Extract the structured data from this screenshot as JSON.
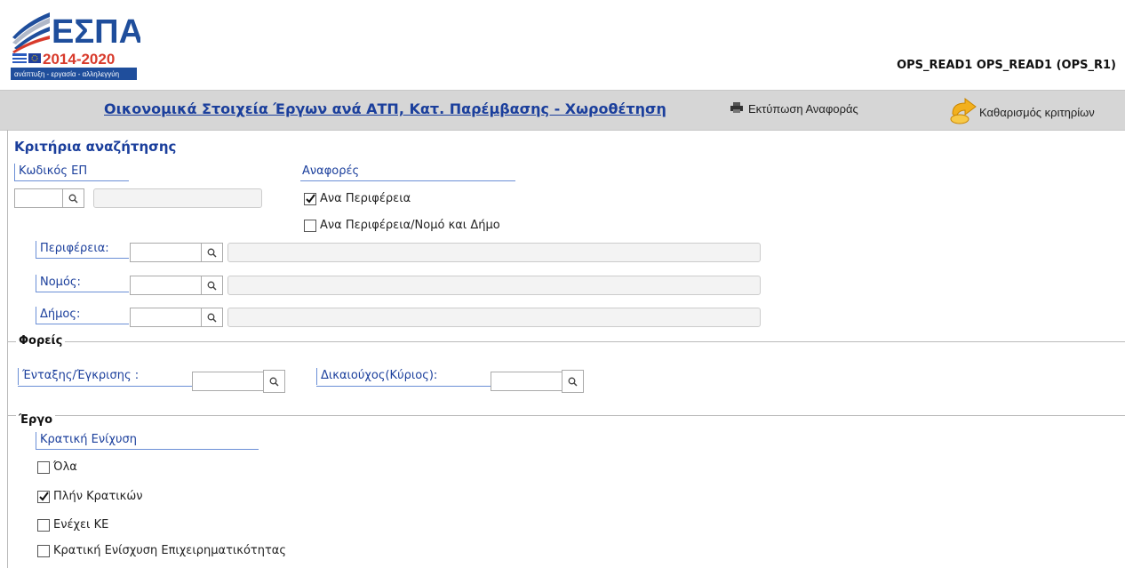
{
  "header": {
    "logo_text": "ΕΣΠΑ",
    "logo_years": "2014-2020",
    "logo_tagline": "ανάπτυξη - εργασία - αλληλεγγύη",
    "user_info": "OPS_READ1 OPS_READ1 (OPS_R1)"
  },
  "titlebar": {
    "report_title": "Οικονομικά Στοιχεία Έργων ανά ΑΤΠ, Κατ. Παρέμβασης - Χωροθέτηση",
    "print_label": "Εκτύπωση Αναφοράς",
    "clear_label": "Καθαρισμός κριτηρίων"
  },
  "criteria": {
    "title": "Κριτήρια αναζήτησης",
    "code_ep_label": "Κωδικός ΕΠ",
    "code_ep_value": "",
    "reports_label": "Αναφορές",
    "reports_options": [
      {
        "label": "Ανα Περιφέρεια",
        "checked": true
      },
      {
        "label": "Ανα Περιφέρεια/Νομό και Δήμο",
        "checked": false
      }
    ],
    "region_label": "Περιφέρεια:",
    "prefecture_label": "Νομός:",
    "municipality_label": "Δήμος:"
  },
  "bodies": {
    "legend": "Φορείς",
    "approval_label": "Ένταξης/Έγκρισης :",
    "beneficiary_label": "Δικαιούχος(Κύριος):"
  },
  "project": {
    "legend": "Έργο",
    "state_aid_label": "Κρατική Ενίχυση",
    "options": [
      {
        "label": "Όλα",
        "checked": false
      },
      {
        "label": "Πλήν Κρατικών",
        "checked": true
      },
      {
        "label": "Ενέχει ΚΕ",
        "checked": false
      },
      {
        "label": "Κρατική Ενίσχυση Επιχειρηματικότητας",
        "checked": false
      }
    ]
  },
  "colors": {
    "accent_blue": "#1b3f9c",
    "titlebar_bg": "#d6d6d6"
  }
}
